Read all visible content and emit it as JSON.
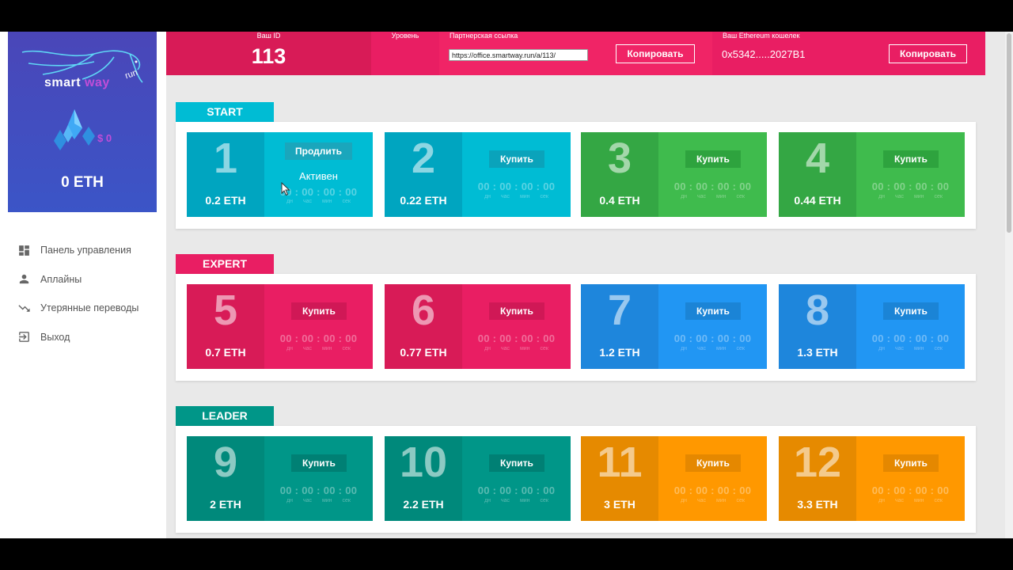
{
  "sidebar": {
    "logo": {
      "text_main": "smart ",
      "text_accent": "way",
      "text_run": "run"
    },
    "balance_usd": "$ 0",
    "balance_eth": "0 ETH",
    "items": [
      {
        "label": "Панель управления",
        "icon": "dashboard-icon"
      },
      {
        "label": "Аплайны",
        "icon": "person-icon"
      },
      {
        "label": "Утерянные переводы",
        "icon": "trending-down-icon"
      },
      {
        "label": "Выход",
        "icon": "exit-icon"
      }
    ]
  },
  "header": {
    "id_label": "Ваш ID",
    "id_value": "113",
    "level_label": "Уровень",
    "ref_label": "Партнерская ссылка",
    "ref_value": "https://office.smartway.run/a/113/",
    "copy_label": "Копировать",
    "wallet_label": "Ваш Ethereum кошелек",
    "wallet_value": "0x5342.....2027B1"
  },
  "timer": {
    "text": "00 : 00 : 00 : 00",
    "units": "дн час мин сек"
  },
  "sections": [
    {
      "name": "START",
      "color": "#00bcd4",
      "cards": [
        {
          "num": "1",
          "price": "0.2 ETH",
          "button": "Продлить",
          "status": "Активен",
          "active": true,
          "dark": "#00a5c0",
          "light": "#00bcd4",
          "btn": "#1aa6bc"
        },
        {
          "num": "2",
          "price": "0.22 ETH",
          "button": "Купить",
          "dark": "#00a5c0",
          "light": "#00bcd4",
          "btn": "#0aa3bb"
        },
        {
          "num": "3",
          "price": "0.4 ETH",
          "button": "Купить",
          "dark": "#34a744",
          "light": "#3fbb4d",
          "btn": "#2ea33e"
        },
        {
          "num": "4",
          "price": "0.44 ETH",
          "button": "Купить",
          "dark": "#34a744",
          "light": "#3fbb4d",
          "btn": "#2ea33e"
        }
      ]
    },
    {
      "name": "EXPERT",
      "color": "#e91e63",
      "cards": [
        {
          "num": "5",
          "price": "0.7 ETH",
          "button": "Купить",
          "dark": "#d81b57",
          "light": "#e91e63",
          "btn": "#d01856"
        },
        {
          "num": "6",
          "price": "0.77 ETH",
          "button": "Купить",
          "dark": "#d81b57",
          "light": "#e91e63",
          "btn": "#d01856"
        },
        {
          "num": "7",
          "price": "1.2 ETH",
          "button": "Купить",
          "dark": "#1e86dc",
          "light": "#2196f3",
          "btn": "#1b84d6"
        },
        {
          "num": "8",
          "price": "1.3 ETH",
          "button": "Купить",
          "dark": "#1e86dc",
          "light": "#2196f3",
          "btn": "#1b84d6"
        }
      ]
    },
    {
      "name": "LEADER",
      "color": "#009688",
      "cards": [
        {
          "num": "9",
          "price": "2 ETH",
          "button": "Купить",
          "dark": "#00897b",
          "light": "#009688",
          "btn": "#008074"
        },
        {
          "num": "10",
          "price": "2.2 ETH",
          "button": "Купить",
          "dark": "#00897b",
          "light": "#009688",
          "btn": "#008074"
        },
        {
          "num": "11",
          "price": "3 ETH",
          "button": "Купить",
          "dark": "#e68a00",
          "light": "#ff9800",
          "btn": "#e58800"
        },
        {
          "num": "12",
          "price": "3.3 ETH",
          "button": "Купить",
          "dark": "#e68a00",
          "light": "#ff9800",
          "btn": "#e58800"
        }
      ]
    }
  ]
}
